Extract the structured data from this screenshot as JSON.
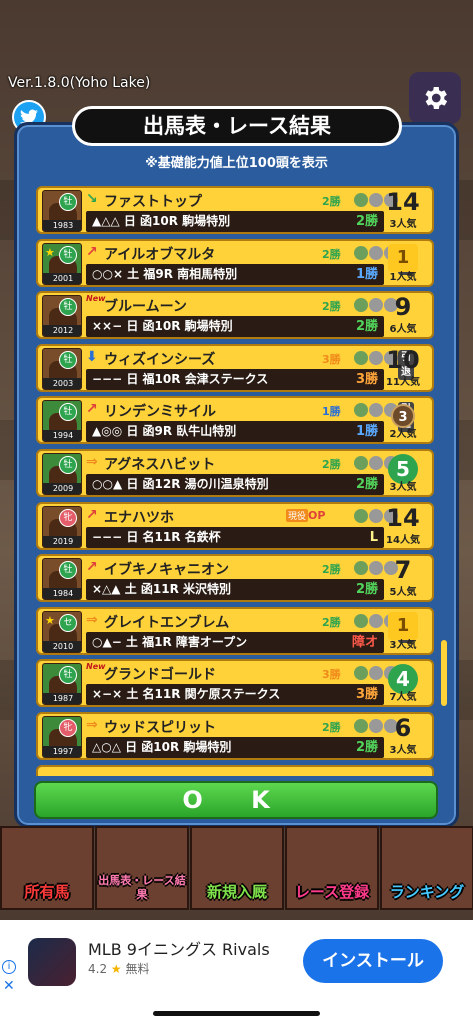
{
  "version": "Ver.1.8.0(Yoho Lake)",
  "panel": {
    "title": "出馬表・レース結果",
    "subtitle": "※基礎能力値上位100頭を表示",
    "ok_label": "O K"
  },
  "horses": [
    {
      "sex": "牡",
      "year": "1983",
      "arrow": "down-r",
      "new": false,
      "name": "ファストトップ",
      "wins": "2勝",
      "wins_color": "green",
      "retired": false,
      "marks": "▲△△ 日 函10R  駒場特別",
      "result": "2勝",
      "result_color": "green",
      "rank": "14",
      "rank_style": "num",
      "popularity": "3人気",
      "thumb": "brown",
      "star": false
    },
    {
      "sex": "牡",
      "year": "2001",
      "arrow": "up",
      "new": false,
      "name": "アイルオブマルタ",
      "wins": "2勝",
      "wins_color": "green",
      "retired": true,
      "marks": "○○× 土 福9R   南相馬特別",
      "result": "1勝",
      "result_color": "blue",
      "rank": "1",
      "rank_style": "gold-t",
      "popularity": "1人気",
      "thumb": "green",
      "star": true
    },
    {
      "sex": "牡",
      "year": "2012",
      "arrow": "",
      "new": true,
      "name": "ブルームーン",
      "wins": "2勝",
      "wins_color": "green",
      "retired": false,
      "marks": "××− 日 函10R  駒場特別",
      "result": "2勝",
      "result_color": "green",
      "rank": "9",
      "rank_style": "num",
      "popularity": "6人気",
      "thumb": "brown",
      "star": false
    },
    {
      "sex": "牡",
      "year": "2003",
      "arrow": "down",
      "new": false,
      "name": "ウィズインシーズ",
      "wins": "3勝",
      "wins_color": "orange",
      "retired": true,
      "marks": "−−− 日 福10R  会津ステークス",
      "result": "3勝",
      "result_color": "orange",
      "rank": "10",
      "rank_style": "num",
      "popularity": "11人気",
      "thumb": "brown",
      "star": false
    },
    {
      "sex": "牡",
      "year": "1994",
      "arrow": "up",
      "new": false,
      "name": "リンデンミサイル",
      "wins": "1勝",
      "wins_color": "blue",
      "retired": true,
      "marks": "▲◎◎ 日 函9R   臥牛山特別",
      "result": "1勝",
      "result_color": "blue",
      "rank": "3",
      "rank_style": "medal",
      "popularity": "2人気",
      "thumb": "green",
      "star": false
    },
    {
      "sex": "牡",
      "year": "2009",
      "arrow": "right",
      "new": false,
      "name": "アグネスハビット",
      "wins": "2勝",
      "wins_color": "green",
      "retired": false,
      "marks": "○○▲ 日 函12R  湯の川温泉特別",
      "result": "2勝",
      "result_color": "green",
      "rank": "5",
      "rank_style": "wreath",
      "popularity": "3人気",
      "thumb": "green",
      "star": false
    },
    {
      "sex": "牝",
      "year": "2019",
      "arrow": "up",
      "new": false,
      "name": "エナハツホ",
      "wins": "OP",
      "wins_color": "op",
      "sub": "現役",
      "retired": false,
      "marks": "−−− 日 名11R  名鉄杯",
      "result": "L",
      "result_color": "yellow",
      "rank": "14",
      "rank_style": "num",
      "popularity": "14人気",
      "thumb": "brown",
      "star": false
    },
    {
      "sex": "牡",
      "year": "1984",
      "arrow": "up",
      "new": false,
      "name": "イブキノキャニオン",
      "wins": "2勝",
      "wins_color": "green",
      "retired": false,
      "marks": "×△▲ 土 函11R  米沢特別",
      "result": "2勝",
      "result_color": "green",
      "rank": "7",
      "rank_style": "num",
      "popularity": "5人気",
      "thumb": "brown",
      "star": false
    },
    {
      "sex": "セ",
      "year": "2010",
      "arrow": "right",
      "new": false,
      "name": "グレイトエンブレム",
      "wins": "2勝",
      "wins_color": "green",
      "retired": true,
      "marks": "○▲− 土 福1R   障害オープン",
      "result": "障オ",
      "result_color": "red",
      "rank": "1",
      "rank_style": "gold-t",
      "popularity": "3人気",
      "thumb": "brown",
      "star": true
    },
    {
      "sex": "牡",
      "year": "1987",
      "arrow": "",
      "new": true,
      "name": "グランドゴールド",
      "wins": "3勝",
      "wins_color": "orange",
      "retired": false,
      "marks": "×−× 土 名11R  関ケ原ステークス",
      "result": "3勝",
      "result_color": "orange",
      "rank": "4",
      "rank_style": "wreath",
      "popularity": "7人気",
      "thumb": "green",
      "star": false
    },
    {
      "sex": "牝",
      "year": "1997",
      "arrow": "right",
      "new": false,
      "name": "ウッドスピリット",
      "wins": "2勝",
      "wins_color": "green",
      "retired": false,
      "marks": "△○△ 日 函10R  駒場特別",
      "result": "2勝",
      "result_color": "green",
      "rank": "6",
      "rank_style": "num",
      "popularity": "3人気",
      "thumb": "green",
      "star": false
    }
  ],
  "menu": [
    {
      "label": "所有馬",
      "color": "red"
    },
    {
      "label": "出馬表・レース結果",
      "color": "pink"
    },
    {
      "label": "新規入厩",
      "color": "green"
    },
    {
      "label": "レース登録",
      "color": "purple"
    },
    {
      "label": "ランキング",
      "color": "cyan"
    }
  ],
  "ad": {
    "app_name": "MLB 9イニングス Rivals",
    "rating": "4.2",
    "price": "無料",
    "install_label": "インストール"
  },
  "retire_label": "引退",
  "colors": {
    "panel_blue": "#2a5c9e",
    "row_yellow": "#ffd23a",
    "ok_green": "#2aa52a",
    "install_blue": "#1a73e8"
  }
}
